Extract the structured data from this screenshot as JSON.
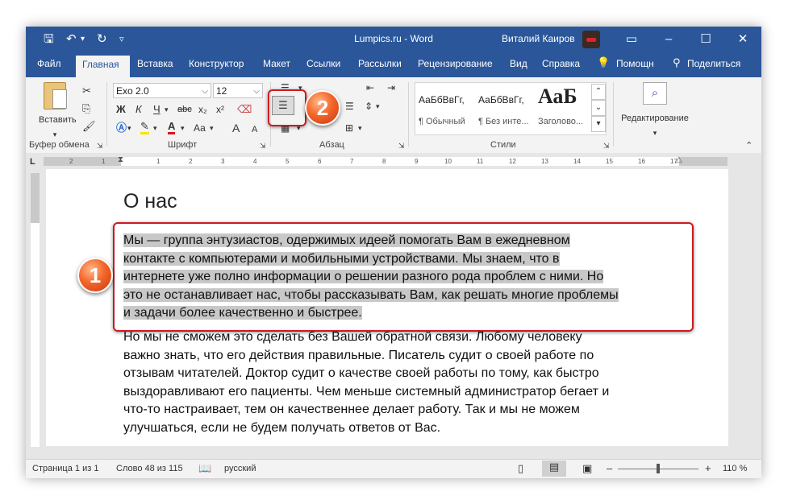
{
  "window": {
    "title": "Lumpics.ru - Word",
    "user_name": "Виталий Каиров",
    "qat": {
      "save_icon": "save-icon",
      "undo_icon": "undo-icon",
      "redo_icon": "redo-icon"
    }
  },
  "tabs": [
    {
      "label": "Файл",
      "active": false
    },
    {
      "label": "Главная",
      "active": true
    },
    {
      "label": "Вставка",
      "active": false
    },
    {
      "label": "Конструктор",
      "active": false
    },
    {
      "label": "Макет",
      "active": false
    },
    {
      "label": "Ссылки",
      "active": false
    },
    {
      "label": "Рассылки",
      "active": false
    },
    {
      "label": "Рецензирование",
      "active": false
    },
    {
      "label": "Вид",
      "active": false
    },
    {
      "label": "Справка",
      "active": false
    }
  ],
  "help": {
    "label": "Помощн"
  },
  "share": {
    "label": "Поделиться"
  },
  "ribbon": {
    "clipboard": {
      "paste_label": "Вставить",
      "group_label": "Буфер обмена"
    },
    "font": {
      "font_name": "Exo 2.0",
      "font_size": "12",
      "group_label": "Шрифт",
      "bold": "Ж",
      "italic": "К",
      "underline": "Ч",
      "strike": "abc",
      "subscript": "x₂",
      "superscript": "x²",
      "font_color_letter": "А",
      "change_case": "Аа",
      "grow": "А",
      "shrink": "А"
    },
    "paragraph": {
      "group_label": "Абзац"
    },
    "styles": {
      "group_label": "Стили",
      "items": [
        {
          "sample": "АаБбВвГг,",
          "name": "¶ Обычный"
        },
        {
          "sample": "АаБбВвГг,",
          "name": "¶ Без инте..."
        },
        {
          "sample": "АаБ",
          "name": "Заголово..."
        }
      ]
    },
    "editing": {
      "label": "Редактирование"
    }
  },
  "ruler": {
    "left_labels": [
      "2",
      "1"
    ],
    "right_labels": [
      "1",
      "2",
      "3",
      "4",
      "5",
      "6",
      "7",
      "8",
      "9",
      "10",
      "11",
      "12",
      "13",
      "14",
      "15",
      "16",
      "17"
    ]
  },
  "document": {
    "heading": "О нас",
    "paragraph1_lines": [
      "Мы — группа энтузиастов, одержимых идеей помогать Вам в ежедневном",
      "контакте с компьютерами и мобильными устройствами. Мы знаем, что в",
      "интернете уже полно информации о решении разного рода проблем с ними. Но",
      "это не останавливает нас, чтобы рассказывать Вам, как решать многие проблемы",
      "и задачи более качественно и быстрее."
    ],
    "paragraph2_lines": [
      "Но мы не сможем это сделать без Вашей обратной связи. Любому человеку",
      "важно знать, что его действия правильные. Писатель судит о своей работе по",
      "отзывам читателей. Доктор судит о качестве своей работы по тому, как быстро",
      "выздоравливают его пациенты. Чем меньше системный администратор бегает и",
      "что-то настраивает, тем он качественнее делает работу. Так и мы не можем",
      "улучшаться, если не будем получать ответов от Вас."
    ]
  },
  "status": {
    "page": "Страница 1 из 1",
    "words": "Слово 48 из 115",
    "language": "русский",
    "zoom": "110 %"
  },
  "annotations": {
    "badge1": "1",
    "badge2": "2",
    "accent_color": "#d0191f",
    "badge_color": "#f4662a"
  },
  "colors": {
    "titlebar": "#2b579a",
    "ribbon": "#f3f3f3",
    "highlight": "#c8c8c8"
  }
}
